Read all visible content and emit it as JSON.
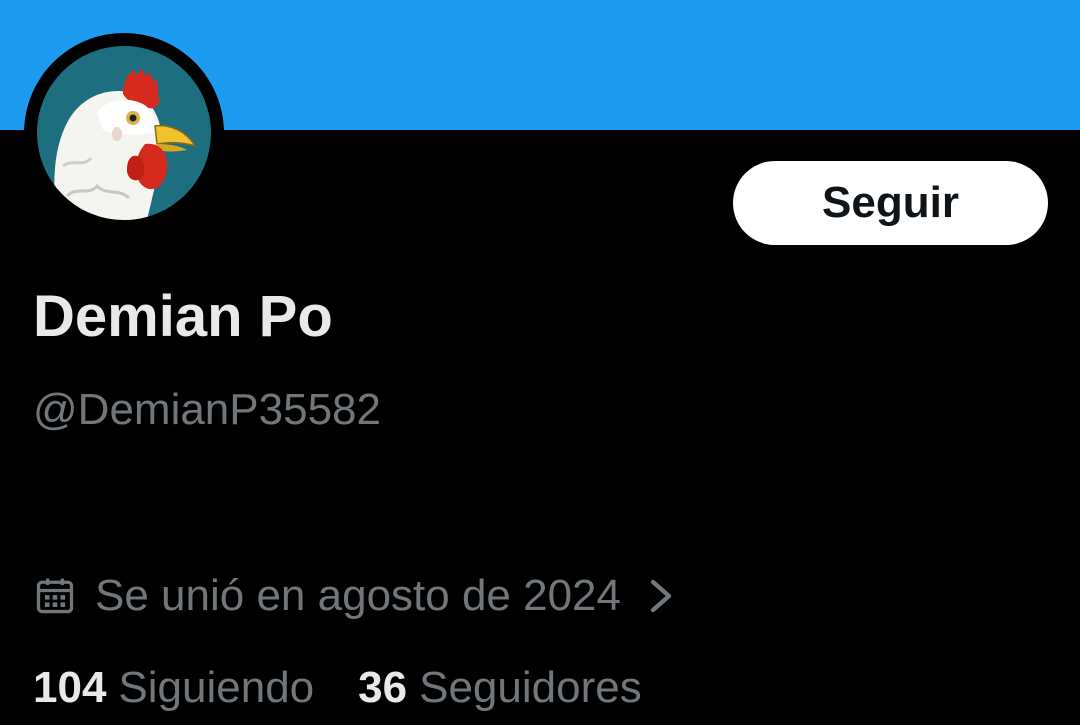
{
  "colors": {
    "banner": "#1d9bf0",
    "background": "#000000",
    "primary_text": "#e7e9ea",
    "secondary_text": "#71767b",
    "button_bg": "#ffffff",
    "button_text": "#0f1419"
  },
  "profile": {
    "avatar_icon": "rooster-avatar",
    "display_name": "Demian Po",
    "handle": "@DemianP35582",
    "joined_icon": "calendar-icon",
    "joined_text": "Se unió en agosto de 2024",
    "joined_chevron_icon": "chevron-right-icon"
  },
  "actions": {
    "follow_label": "Seguir"
  },
  "stats": {
    "following_count": "104",
    "following_label": "Siguiendo",
    "followers_count": "36",
    "followers_label": "Seguidores"
  }
}
